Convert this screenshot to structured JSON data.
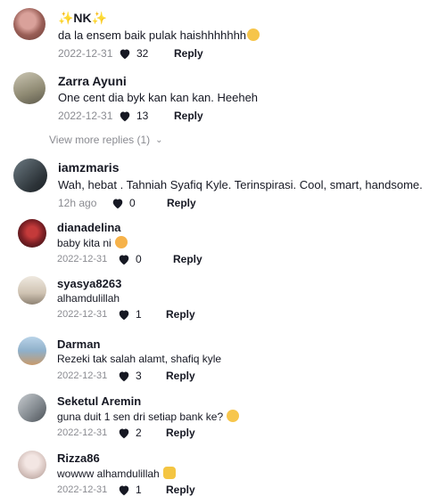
{
  "comments": [
    {
      "username": "✨NK✨",
      "text": "da la ensem baik pulak haishhhhhhh",
      "emoji": "relieved-face-emoji",
      "date": "2022-12-31",
      "likes": "32",
      "reply": "Reply",
      "avatar_color": "#b87c73"
    },
    {
      "username": "Zarra Ayuni",
      "text": "One cent dia byk kan kan kan. Heeheh",
      "date": "2022-12-31",
      "likes": "13",
      "reply": "Reply",
      "avatar_color": "#a7a088"
    },
    {
      "username": "iamzmaris",
      "text": "Wah, hebat . Tahniah Syafiq Kyle. Terinspirasi. Cool, smart, handsome.",
      "date": "12h ago",
      "likes": "0",
      "reply": "Reply",
      "avatar_color": "#3f4a52"
    },
    {
      "username": "dianadelina",
      "text": "baby kita ni",
      "emoji": "smiling-hearts-emoji",
      "date": "2022-12-31",
      "likes": "0",
      "reply": "Reply",
      "avatar_color": "#8c2a2a"
    },
    {
      "username": "syasya8263",
      "text": "alhamdulillah",
      "date": "2022-12-31",
      "likes": "1",
      "reply": "Reply",
      "avatar_color": "#d9d1c4"
    },
    {
      "username": "Darman",
      "text": "Rezeki tak salah alamt, shafiq kyle",
      "date": "2022-12-31",
      "likes": "3",
      "reply": "Reply",
      "avatar_color": "#9bb7cf"
    },
    {
      "username": "Seketul Aremin",
      "text": "guna duit 1 sen dri setiap bank ke?",
      "emoji": "flushed-face-emoji",
      "date": "2022-12-31",
      "likes": "2",
      "reply": "Reply",
      "avatar_color": "#8f959a"
    },
    {
      "username": "Rizza86",
      "text": "wowww alhamdulillah",
      "emoji": "raising-hands-emoji",
      "date": "2022-12-31",
      "likes": "1",
      "reply": "Reply",
      "avatar_color": "#e6d9d6"
    }
  ],
  "view_more": {
    "label": "View more replies (1)"
  },
  "colors": {
    "text": "#161823",
    "muted": "#8a8b91",
    "heart": "#161823"
  }
}
